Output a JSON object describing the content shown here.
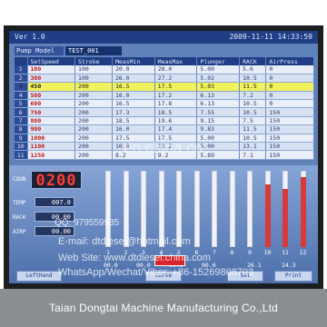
{
  "header": {
    "version": "Ver 1.0",
    "datetime": "2009-11-11 14:33:59"
  },
  "pump": {
    "label": "Pump Model",
    "value": "TEST_001"
  },
  "table": {
    "columns": [
      "SetSpeed",
      "Stroke",
      "MeasMin",
      "MeasMax",
      "Plunger",
      "RACK",
      "AirPress"
    ],
    "rows": [
      {
        "icon": "1",
        "speed": "100",
        "stroke": "100",
        "min": "20.0",
        "max": "28.0",
        "plunger": "5.00",
        "rack": "5.6",
        "air": "0"
      },
      {
        "icon": "2",
        "speed": "300",
        "stroke": "100",
        "min": "26.0",
        "max": "27.2",
        "plunger": "5.02",
        "rack": "10.5",
        "air": "0"
      },
      {
        "icon": "3",
        "speed": "450",
        "stroke": "200",
        "min": "16.5",
        "max": "17.5",
        "plunger": "5.03",
        "rack": "11.5",
        "air": "0"
      },
      {
        "icon": "4",
        "speed": "500",
        "stroke": "200",
        "min": "16.0",
        "max": "17.2",
        "plunger": "6.13",
        "rack": "7.2",
        "air": "0"
      },
      {
        "icon": "5",
        "speed": "600",
        "stroke": "200",
        "min": "16.5",
        "max": "17.8",
        "plunger": "6.13",
        "rack": "10.5",
        "air": "0"
      },
      {
        "icon": "6",
        "speed": "750",
        "stroke": "200",
        "min": "17.3",
        "max": "18.5",
        "plunger": "7.55",
        "rack": "10.5",
        "air": "150"
      },
      {
        "icon": "7",
        "speed": "800",
        "stroke": "200",
        "min": "18.5",
        "max": "19.6",
        "plunger": "9.15",
        "rack": "7.5",
        "air": "150"
      },
      {
        "icon": "8",
        "speed": "900",
        "stroke": "200",
        "min": "16.0",
        "max": "17.4",
        "plunger": "9.83",
        "rack": "11.5",
        "air": "150"
      },
      {
        "icon": "9",
        "speed": "1000",
        "stroke": "200",
        "min": "17.5",
        "max": "17.5",
        "plunger": "5.00",
        "rack": "10.5",
        "air": "150"
      },
      {
        "icon": "10",
        "speed": "1100",
        "stroke": "200",
        "min": "10.0",
        "max": "13.2",
        "plunger": "5.00",
        "rack": "13.1",
        "air": "150"
      },
      {
        "icon": "11",
        "speed": "1250",
        "stroke": "200",
        "min": "8.2",
        "max": "9.2",
        "plunger": "5.89",
        "rack": "7.1",
        "air": "150"
      }
    ]
  },
  "count": {
    "label": "COUN",
    "value": "0200"
  },
  "params": [
    {
      "label": "TEMP",
      "value": "007.0"
    },
    {
      "label": "RACK",
      "value": "00.00"
    },
    {
      "label": "AIRP",
      "value": "00.00"
    }
  ],
  "bars": {
    "numbers": [
      "1",
      "2",
      "3",
      "4",
      "5",
      "6",
      "7",
      "8",
      "9",
      "10",
      "11",
      "12"
    ],
    "fill_fraction": [
      0,
      0,
      0,
      0,
      0,
      0,
      0,
      0,
      0,
      0.82,
      0.76,
      0.92
    ]
  },
  "readouts": [
    "00.0",
    "00.0",
    "00.0",
    "00.0",
    "26.1",
    "24.3"
  ],
  "buttons": [
    "LeftHand",
    "Curve",
    "Set",
    "Print"
  ],
  "watermark": {
    "center": "en.china.cn",
    "qq": "QQ: 979559935",
    "email": "E-mail: dtdiesel@hotmail.com",
    "site": "Web Site: www.dtdiesel.china.com",
    "whatsapp": "WhatsApp/Wechat/Viber: +86-15269808703"
  },
  "footer": "Taian Dongtai Machine Manufacturing Co.,Ltd",
  "colors": {
    "title_bar": "#1f3e86",
    "highlight_row": "#f2f25c",
    "led_red": "#ff3d32",
    "bar_red": "#d63a3a",
    "screen_blue": "#5f82b9"
  }
}
